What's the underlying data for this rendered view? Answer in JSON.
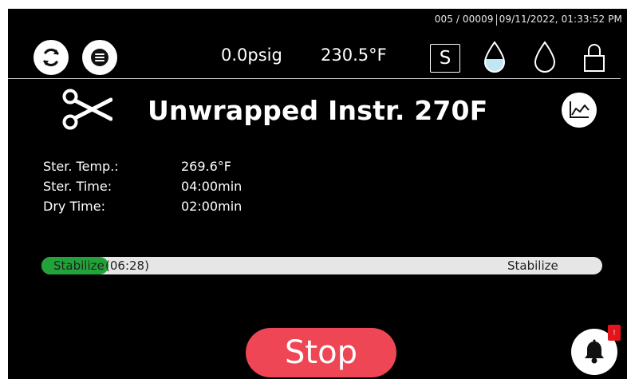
{
  "status_bar": {
    "counter": "005 / 00009",
    "datetime": "09/11/2022, 01:33:52 PM"
  },
  "header": {
    "pressure": "0.0psig",
    "temperature": "230.5°F",
    "mode_letter": "S"
  },
  "program": {
    "title": "Unwrapped Instr. 270F"
  },
  "parameters": [
    {
      "label": "Ster. Temp.:",
      "value": "269.6°F"
    },
    {
      "label": "Ster. Time:",
      "value": "04:00min"
    },
    {
      "label": "Dry Time:",
      "value": "02:00min"
    }
  ],
  "progress": {
    "current_stage": "Stabilize",
    "elapsed": "(06:28)",
    "end_stage": "Stabilize",
    "fraction": 0.12,
    "fill_color": "#22a33a"
  },
  "actions": {
    "stop_label": "Stop"
  },
  "notifications": {
    "badge": "!"
  },
  "icons": {
    "cycle": "cycle-icon",
    "menu": "menu-icon",
    "water_full": "water-drop-filled-icon",
    "water_empty": "water-drop-outline-icon",
    "lock": "lock-icon",
    "program": "scissors-icon",
    "graph": "graph-icon",
    "bell": "bell-icon"
  },
  "colors": {
    "accent_stop": "#ef4655",
    "water_fill": "#bfe6f2",
    "background": "#000000"
  }
}
